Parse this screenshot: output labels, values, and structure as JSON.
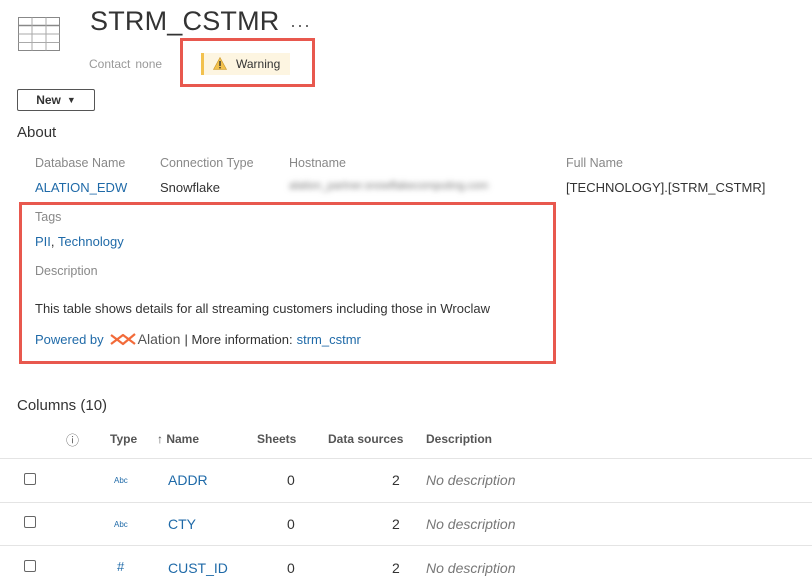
{
  "header": {
    "title": "STRM_CSTMR",
    "more_label": "···",
    "contact_label": "Contact",
    "contact_value": "none",
    "warning_label": "Warning",
    "new_button_label": "New"
  },
  "about": {
    "title": "About",
    "fields": [
      {
        "label": "Database Name",
        "value": "ALATION_EDW"
      },
      {
        "label": "Connection Type",
        "value": "Snowflake"
      },
      {
        "label": "Hostname",
        "value": "alation_partner.snowflakecomputing.com"
      },
      {
        "label": "Full Name",
        "value": "[TECHNOLOGY].[STRM_CSTMR]"
      }
    ],
    "tags_label": "Tags",
    "tags": [
      "PII",
      "Technology"
    ],
    "tags_separator": ",",
    "description_label": "Description",
    "description": "This table shows details for all streaming customers including those in Wroclaw",
    "powered_by": "Powered by",
    "alation_name": "Alation",
    "more_info": "| More information:",
    "more_info_link": "strm_cstmr"
  },
  "columns": {
    "title": "Columns (10)",
    "headers": {
      "info": "ⓘ",
      "type": "Type",
      "sort_arrow": "↑",
      "name": "Name",
      "sheets": "Sheets",
      "data_sources": "Data sources",
      "description": "Description"
    },
    "rows": [
      {
        "type": "Abc",
        "name": "ADDR",
        "sheets": "0",
        "data_sources": "2",
        "description": "No description"
      },
      {
        "type": "Abc",
        "name": "CTY",
        "sheets": "0",
        "data_sources": "2",
        "description": "No description"
      },
      {
        "type": "#",
        "name": "CUST_ID",
        "sheets": "0",
        "data_sources": "2",
        "description": "No description"
      }
    ]
  },
  "colors": {
    "link": "#1f6aa8",
    "highlight_frame": "#e8584e",
    "warning_accent": "#f2c14e",
    "alation_orange": "#f26b3a"
  },
  "icons": [
    "table-icon",
    "warning-icon",
    "caret-down-icon",
    "info-icon",
    "sort-up-icon",
    "alation-logo"
  ]
}
